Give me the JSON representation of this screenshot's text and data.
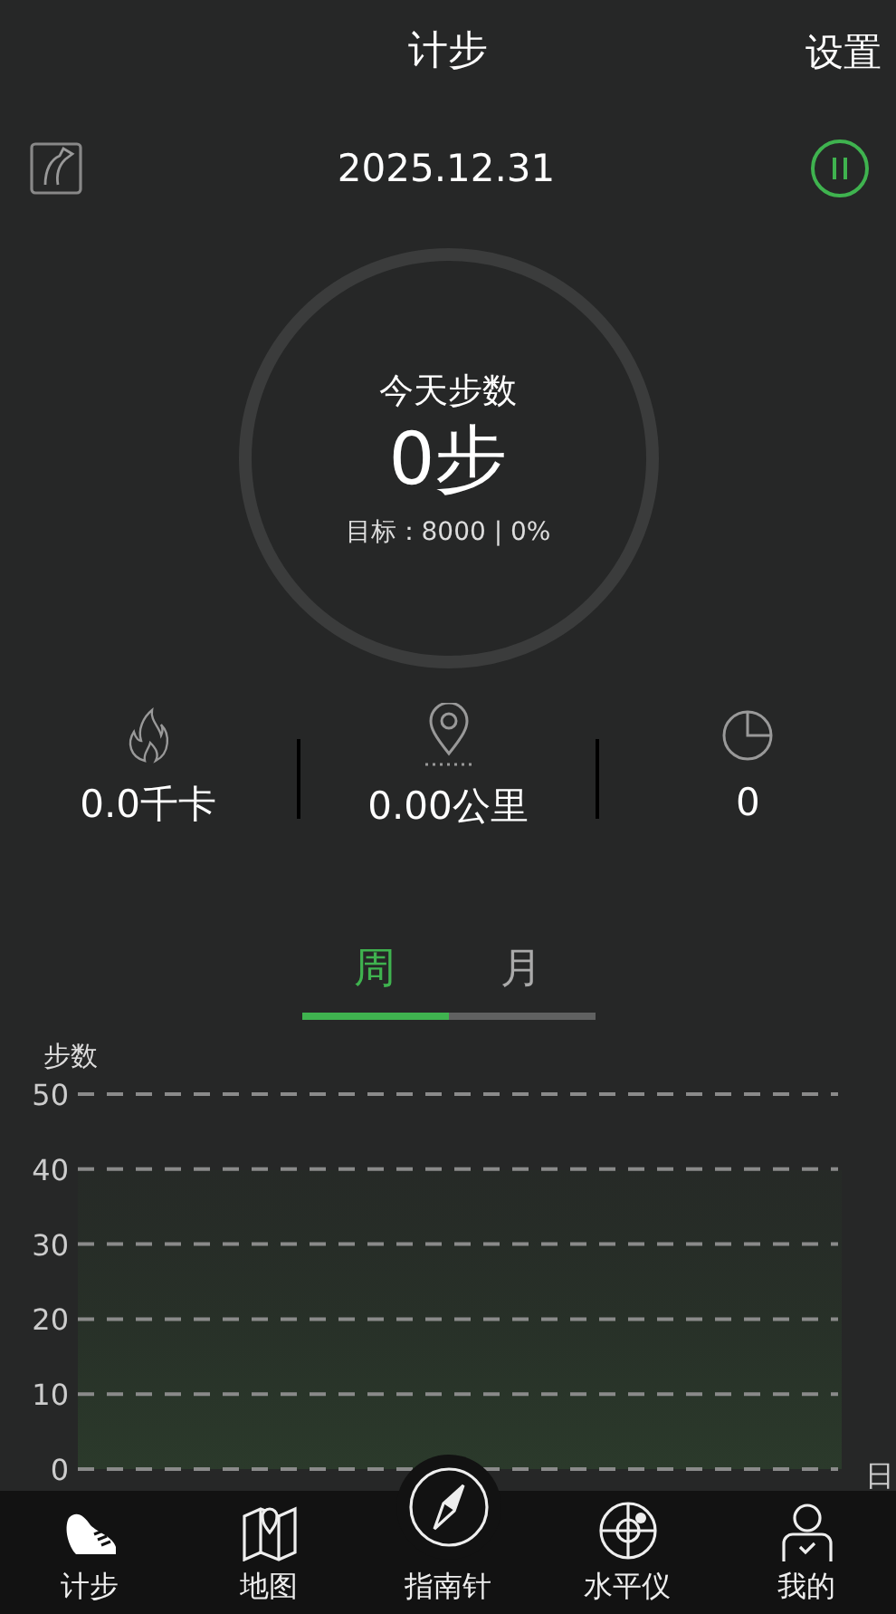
{
  "header": {
    "title": "计步",
    "settings": "设置"
  },
  "date_bar": {
    "date": "2025.12.31"
  },
  "today": {
    "label": "今天步数",
    "steps": "0步",
    "goal": "目标：8000 | 0%"
  },
  "stats": [
    {
      "kind": "calories",
      "value": "0.0千卡"
    },
    {
      "kind": "distance",
      "value": "0.00公里"
    },
    {
      "kind": "time",
      "value": "0"
    }
  ],
  "period_tabs": [
    {
      "label": "周",
      "selected": true
    },
    {
      "label": "月",
      "selected": false
    }
  ],
  "chart": {
    "y_axis_title": "步数",
    "x_axis_title": "日",
    "y_tick_labels": [
      "50",
      "40",
      "30",
      "20",
      "10",
      "0"
    ]
  },
  "bottom_nav": [
    {
      "kind": "steps",
      "label": "计步"
    },
    {
      "kind": "map",
      "label": "地图"
    },
    {
      "kind": "compass",
      "label": "指南针"
    },
    {
      "kind": "level",
      "label": "水平仪"
    },
    {
      "kind": "profile",
      "label": "我的"
    }
  ]
}
